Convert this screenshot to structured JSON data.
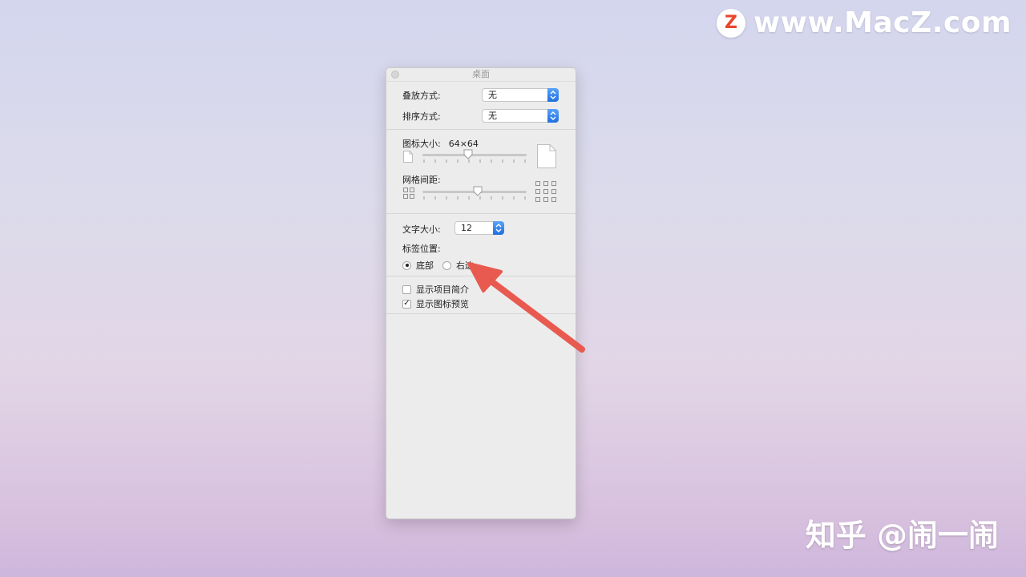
{
  "watermarks": {
    "top_logo_letter": "Z",
    "top_text": "www.MacZ.com",
    "bottom_text": "知乎 @闹一闹"
  },
  "window": {
    "title": "桌面"
  },
  "stacking": {
    "label": "叠放方式:",
    "value": "无"
  },
  "sort": {
    "label": "排序方式:",
    "value": "无"
  },
  "icon_size": {
    "label": "图标大小:",
    "value": "64×64",
    "level": 0.44
  },
  "grid_spacing": {
    "label": "网格间距:",
    "level": 0.53
  },
  "text_size": {
    "label": "文字大小:",
    "value": "12"
  },
  "label_position": {
    "label": "标签位置:",
    "options": [
      {
        "label": "底部",
        "selected": true
      },
      {
        "label": "右边",
        "selected": false
      }
    ]
  },
  "checkboxes": [
    {
      "label": "显示项目简介",
      "checked": false
    },
    {
      "label": "显示图标预览",
      "checked": true
    }
  ],
  "annotation": {
    "arrow_color": "#e85a4f"
  }
}
